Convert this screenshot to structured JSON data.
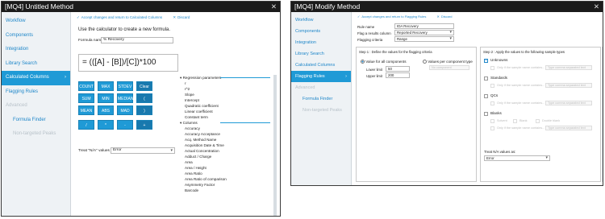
{
  "window1": {
    "title": "[MQ4] Untitled Method",
    "close": "✕",
    "nav": [
      {
        "label": "Workflow"
      },
      {
        "label": "Components"
      },
      {
        "label": "Integration"
      },
      {
        "label": "Library Search"
      },
      {
        "label": "Calculated Columns",
        "active": true
      },
      {
        "label": "Flagging Rules"
      },
      {
        "label": "Advanced",
        "muted": true
      },
      {
        "label": "Formula Finder",
        "sub": true
      },
      {
        "label": "Non-targeted Peaks",
        "sub": true,
        "muted": true
      }
    ],
    "chevron": "›",
    "toolbar": {
      "accept": "Accept changes and return to Calculated Columns",
      "discard": "Discard",
      "accept_icon": "✓",
      "discard_icon": "✕"
    },
    "instruction": "Use the calculator to create a new formula.",
    "formula_name_label": "Formula name",
    "formula_name_value": "% Recovery",
    "formula": "= (([A] - [B])/[C])*100",
    "keypad": [
      [
        "COUNT",
        "MAX",
        "STDEV",
        "Clear"
      ],
      [
        "SUM",
        "MIN",
        "MEDIAN",
        "("
      ],
      [
        "MEAN",
        "ABS",
        "MAD",
        ")"
      ],
      [
        "/",
        "*",
        "-",
        "+"
      ]
    ],
    "regression_header": "Regression parameters",
    "regression": [
      "r",
      "r^2",
      "Slope",
      "Intercept",
      "Quadratic coefficient",
      "Linear coefficient",
      "Constant term"
    ],
    "columns_header": "Columns",
    "columns": [
      "Accuracy",
      "Accuracy Acceptance",
      "Acq. Method Name",
      "Acquisition Date & Time",
      "Actual Concentration",
      "Adduct / Charge",
      "Area",
      "Area / Height",
      "Area Ratio",
      "Area Ratio of comparison",
      "Asymmetry Factor",
      "Barcode"
    ],
    "na_label": "Treat \"N/A\" values as:",
    "na_value": "Error"
  },
  "window2": {
    "title": "[MQ4] Modify Method",
    "close": "✕",
    "nav": [
      {
        "label": "Workflow"
      },
      {
        "label": "Components"
      },
      {
        "label": "Integration"
      },
      {
        "label": "Library Search"
      },
      {
        "label": "Calculated Columns"
      },
      {
        "label": "Flagging Rules",
        "active": true
      },
      {
        "label": "Advanced",
        "muted": true
      },
      {
        "label": "Formula Finder",
        "sub": true
      },
      {
        "label": "Non-targeted Peaks",
        "sub": true,
        "muted": true
      }
    ],
    "chevron": "›",
    "toolbar": {
      "accept": "Accept changes and return to Flagging Rules",
      "discard": "Discard",
      "accept_icon": "✓",
      "discard_icon": "✕"
    },
    "rule_name_label": "Rule name",
    "rule_name_value": "IDA Recovery",
    "flag_col_label": "Flag a results column",
    "flag_col_value": "Reported Recovery",
    "criteria_label": "Flagging criteria",
    "criteria_value": "Range",
    "step1": "Step 1 : Define the values for the flagging criteria",
    "all_components": "Value for all components",
    "per_component": "Values per component type",
    "per_component_dd": "No component",
    "lower_label": "Lower limit",
    "lower_value": "50",
    "upper_label": "Upper limit",
    "upper_value": "200",
    "step2": "Step 2 : Apply the values to the following sample types",
    "groups": [
      {
        "name": "Unknowns",
        "checked": true
      },
      {
        "name": "Standards",
        "checked": false
      },
      {
        "name": "QCs",
        "checked": false
      },
      {
        "name": "Blanks",
        "checked": false
      }
    ],
    "only_if": "Only if the sample name contains...",
    "type_hint": "Type comma separated text",
    "blank_opts": [
      "Solvent",
      "Blank",
      "Double blank"
    ],
    "na_label": "Treat N/A values as:",
    "na_value": "Error"
  }
}
